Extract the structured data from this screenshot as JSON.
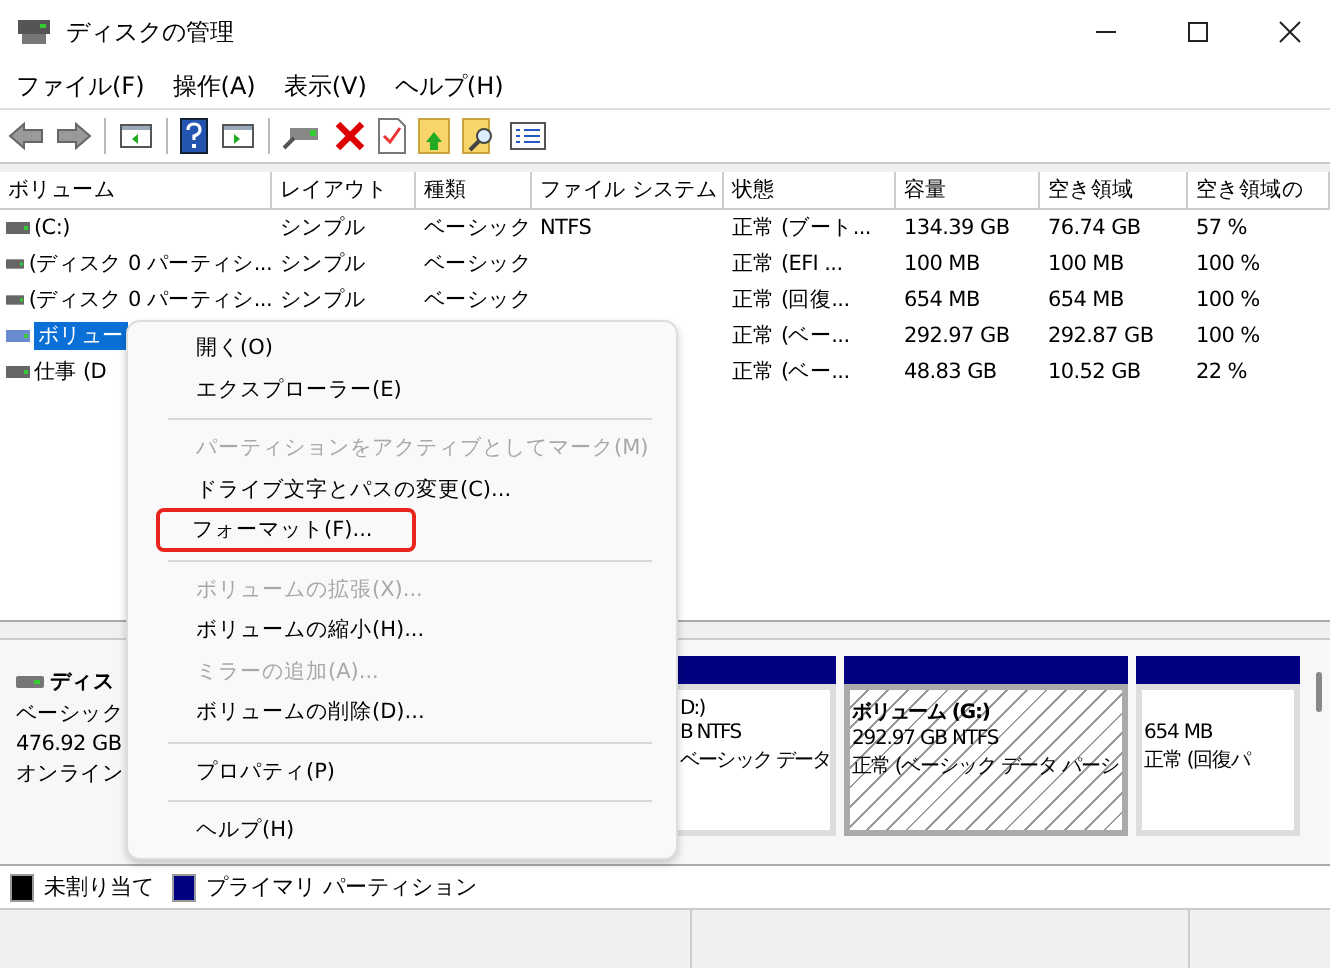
{
  "window": {
    "title": "ディスクの管理"
  },
  "menu_bar": [
    "ファイル(F)",
    "操作(A)",
    "表示(V)",
    "ヘルプ(H)"
  ],
  "table": {
    "columns": [
      "ボリューム",
      "レイアウト",
      "種類",
      "ファイル システム",
      "状態",
      "容量",
      "空き領域",
      "空き領域の"
    ],
    "rows": [
      {
        "cells": [
          "(C:)",
          "シンプル",
          "ベーシック",
          "NTFS",
          "正常 (ブート...",
          "134.39 GB",
          "76.74 GB",
          "57 %"
        ],
        "selected": false
      },
      {
        "cells": [
          "(ディスク 0 パーティシ...",
          "シンプル",
          "ベーシック",
          null,
          "正常 (EFI ...",
          "100 MB",
          "100 MB",
          "100 %"
        ],
        "selected": false
      },
      {
        "cells": [
          "(ディスク 0 パーティシ...",
          "シンプル",
          "ベーシック",
          null,
          "正常 (回復...",
          "654 MB",
          "654 MB",
          "100 %"
        ],
        "selected": false
      },
      {
        "cells": [
          "ボリュー",
          null,
          null,
          null,
          "正常 (ベー...",
          "292.97 GB",
          "292.87 GB",
          "100 %"
        ],
        "selected": true
      },
      {
        "cells": [
          "仕事 (D",
          null,
          null,
          null,
          "正常 (ベー...",
          "48.83 GB",
          "10.52 GB",
          "22 %"
        ],
        "selected": false
      }
    ]
  },
  "context_menu": [
    {
      "kind": "item",
      "label": "開く(O)",
      "disabled": false,
      "marked": false
    },
    {
      "kind": "item",
      "label": "エクスプローラー(E)",
      "disabled": false,
      "marked": false
    },
    {
      "kind": "separator"
    },
    {
      "kind": "item",
      "label": "パーティションをアクティブとしてマーク(M)",
      "disabled": true,
      "marked": false
    },
    {
      "kind": "item",
      "label": "ドライブ文字とパスの変更(C)...",
      "disabled": false,
      "marked": false
    },
    {
      "kind": "item",
      "label": "フォーマット(F)...",
      "disabled": false,
      "marked": true
    },
    {
      "kind": "separator"
    },
    {
      "kind": "item",
      "label": "ボリュームの拡張(X)...",
      "disabled": true,
      "marked": false
    },
    {
      "kind": "item",
      "label": "ボリュームの縮小(H)...",
      "disabled": false,
      "marked": false
    },
    {
      "kind": "item",
      "label": "ミラーの追加(A)...",
      "disabled": true,
      "marked": false
    },
    {
      "kind": "item",
      "label": "ボリュームの削除(D)...",
      "disabled": false,
      "marked": false
    },
    {
      "kind": "separator"
    },
    {
      "kind": "item",
      "label": "プロパティ(P)",
      "disabled": false,
      "marked": false
    },
    {
      "kind": "separator"
    },
    {
      "kind": "item",
      "label": "ヘルプ(H)",
      "disabled": false,
      "marked": false
    }
  ],
  "disk": {
    "name": "ディス",
    "type": "ベーシック",
    "size": "476.92 GB",
    "status": "オンライン",
    "partitions": [
      {
        "lines": [
          "D:)",
          "B NTFS",
          "ベーシック データ"
        ],
        "selected": false,
        "covered": true
      },
      {
        "lines": [
          "ボリューム (G:)",
          "292.97 GB NTFS",
          "正常 (ベーシック データ パーシ"
        ],
        "selected": true,
        "covered": false
      },
      {
        "lines": [
          "654 MB",
          "正常 (回復パ"
        ],
        "selected": false,
        "covered": false
      }
    ]
  },
  "legend": [
    {
      "label": "未割り当て",
      "color": "#000000"
    },
    {
      "label": "プライマリ パーティション",
      "color": "#000080"
    }
  ]
}
